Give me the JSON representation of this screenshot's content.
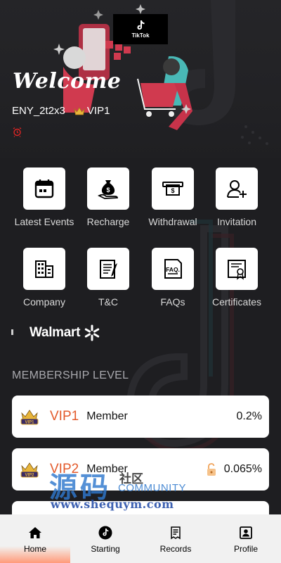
{
  "header": {
    "logo_text": "TikTok",
    "welcome": "Welcome",
    "username": "ENY_2t2x3",
    "vip_level": "VIP1"
  },
  "menu": [
    {
      "label": "Latest Events",
      "icon": "calendar-icon"
    },
    {
      "label": "Recharge",
      "icon": "money-bag-icon"
    },
    {
      "label": "Withdrawal",
      "icon": "cash-withdraw-icon"
    },
    {
      "label": "Invitation",
      "icon": "add-user-icon"
    },
    {
      "label": "Company",
      "icon": "building-icon"
    },
    {
      "label": "T&C",
      "icon": "document-icon"
    },
    {
      "label": "FAQs",
      "icon": "faq-icon"
    },
    {
      "label": "Certificates",
      "icon": "certificate-icon"
    }
  ],
  "partner": {
    "name": "Walmart"
  },
  "membership": {
    "title": "MEMBERSHIP LEVEL",
    "levels": [
      {
        "name": "VIP1",
        "type": "Member",
        "rate": "0.2%",
        "locked": false
      },
      {
        "name": "VIP2",
        "type": "Member",
        "rate": "0.065%",
        "locked": true
      }
    ]
  },
  "watermark": {
    "main": "源码",
    "side": "社区",
    "community": "COMMUNITY",
    "url": "www.shequym.com"
  },
  "nav": [
    {
      "label": "Home",
      "icon": "home-icon",
      "active": true
    },
    {
      "label": "Starting",
      "icon": "tiktok-icon",
      "active": false
    },
    {
      "label": "Records",
      "icon": "records-icon",
      "active": false
    },
    {
      "label": "Profile",
      "icon": "profile-icon",
      "active": false
    }
  ],
  "colors": {
    "background": "#1e1e21",
    "vip_name": "#e35a2b",
    "nav_bg": "#f1f1f1",
    "nav_active": "#ff9a7a"
  }
}
